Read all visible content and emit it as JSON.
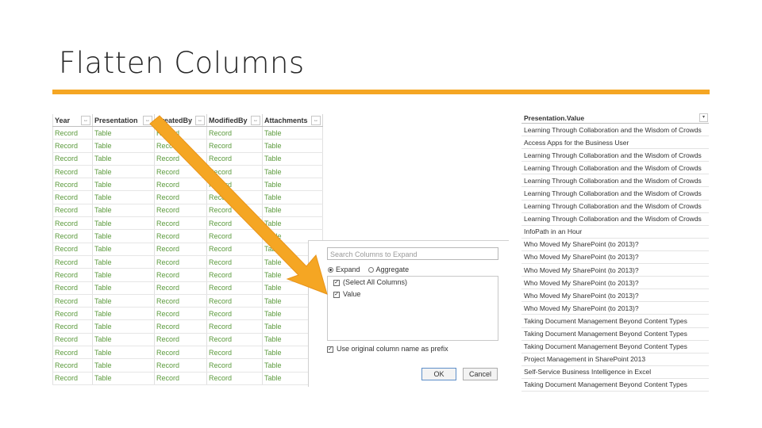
{
  "slide": {
    "title": "Flatten Columns",
    "accent_color": "#f5a623"
  },
  "left_table": {
    "columns": [
      {
        "label": "Year",
        "icon": "↔"
      },
      {
        "label": "Presentation",
        "icon": "↔"
      },
      {
        "label": "CreatedBy",
        "icon": "↔"
      },
      {
        "label": "ModifiedBy",
        "icon": "↔"
      },
      {
        "label": "Attachments",
        "icon": "↔"
      }
    ],
    "rows": [
      [
        "Record",
        "Table",
        "Record",
        "Record",
        "Table"
      ],
      [
        "Record",
        "Table",
        "Record",
        "Record",
        "Table"
      ],
      [
        "Record",
        "Table",
        "Record",
        "Record",
        "Table"
      ],
      [
        "Record",
        "Table",
        "Record",
        "Record",
        "Table"
      ],
      [
        "Record",
        "Table",
        "Record",
        "Record",
        "Table"
      ],
      [
        "Record",
        "Table",
        "Record",
        "Record",
        "Table"
      ],
      [
        "Record",
        "Table",
        "Record",
        "Record",
        "Table"
      ],
      [
        "Record",
        "Table",
        "Record",
        "Record",
        "Table"
      ],
      [
        "Record",
        "Table",
        "Record",
        "Record",
        "Table"
      ],
      [
        "Record",
        "Table",
        "Record",
        "Record",
        "Table"
      ],
      [
        "Record",
        "Table",
        "Record",
        "Record",
        "Table"
      ],
      [
        "Record",
        "Table",
        "Record",
        "Record",
        "Table"
      ],
      [
        "Record",
        "Table",
        "Record",
        "Record",
        "Table"
      ],
      [
        "Record",
        "Table",
        "Record",
        "Record",
        "Table"
      ],
      [
        "Record",
        "Table",
        "Record",
        "Record",
        "Table"
      ],
      [
        "Record",
        "Table",
        "Record",
        "Record",
        "Table"
      ],
      [
        "Record",
        "Table",
        "Record",
        "Record",
        "Table"
      ],
      [
        "Record",
        "Table",
        "Record",
        "Record",
        "Table"
      ],
      [
        "Record",
        "Table",
        "Record",
        "Record",
        "Table"
      ],
      [
        "Record",
        "Table",
        "Record",
        "Record",
        "Table"
      ]
    ]
  },
  "expand_dialog": {
    "search_placeholder": "Search Columns to Expand",
    "expand_label": "Expand",
    "aggregate_label": "Aggregate",
    "select_all_label": "(Select All Columns)",
    "value_label": "Value",
    "prefix_label": "Use original column name as prefix",
    "ok_label": "OK",
    "cancel_label": "Cancel",
    "check_glyph": "✓"
  },
  "right_table": {
    "header": "Presentation.Value",
    "filter_icon": "▾",
    "rows": [
      "Learning Through Collaboration and the Wisdom of Crowds",
      "Access Apps for the Business User",
      "Learning Through Collaboration and the Wisdom of Crowds",
      "Learning Through Collaboration and the Wisdom of Crowds",
      "Learning Through Collaboration and the Wisdom of Crowds",
      "Learning Through Collaboration and the Wisdom of Crowds",
      "Learning Through Collaboration and the Wisdom of Crowds",
      "Learning Through Collaboration and the Wisdom of Crowds",
      "InfoPath in an Hour",
      "Who Moved My SharePoint (to 2013)?",
      "Who Moved My SharePoint (to 2013)?",
      "Who Moved My SharePoint (to 2013)?",
      "Who Moved My SharePoint (to 2013)?",
      "Who Moved My SharePoint (to 2013)?",
      "Who Moved My SharePoint (to 2013)?",
      "Taking Document Management Beyond Content Types",
      "Taking Document Management Beyond Content Types",
      "Taking Document Management Beyond Content Types",
      "Project Management in SharePoint 2013",
      "Self-Service Business Intelligence in Excel",
      "Taking Document Management Beyond Content Types"
    ]
  }
}
